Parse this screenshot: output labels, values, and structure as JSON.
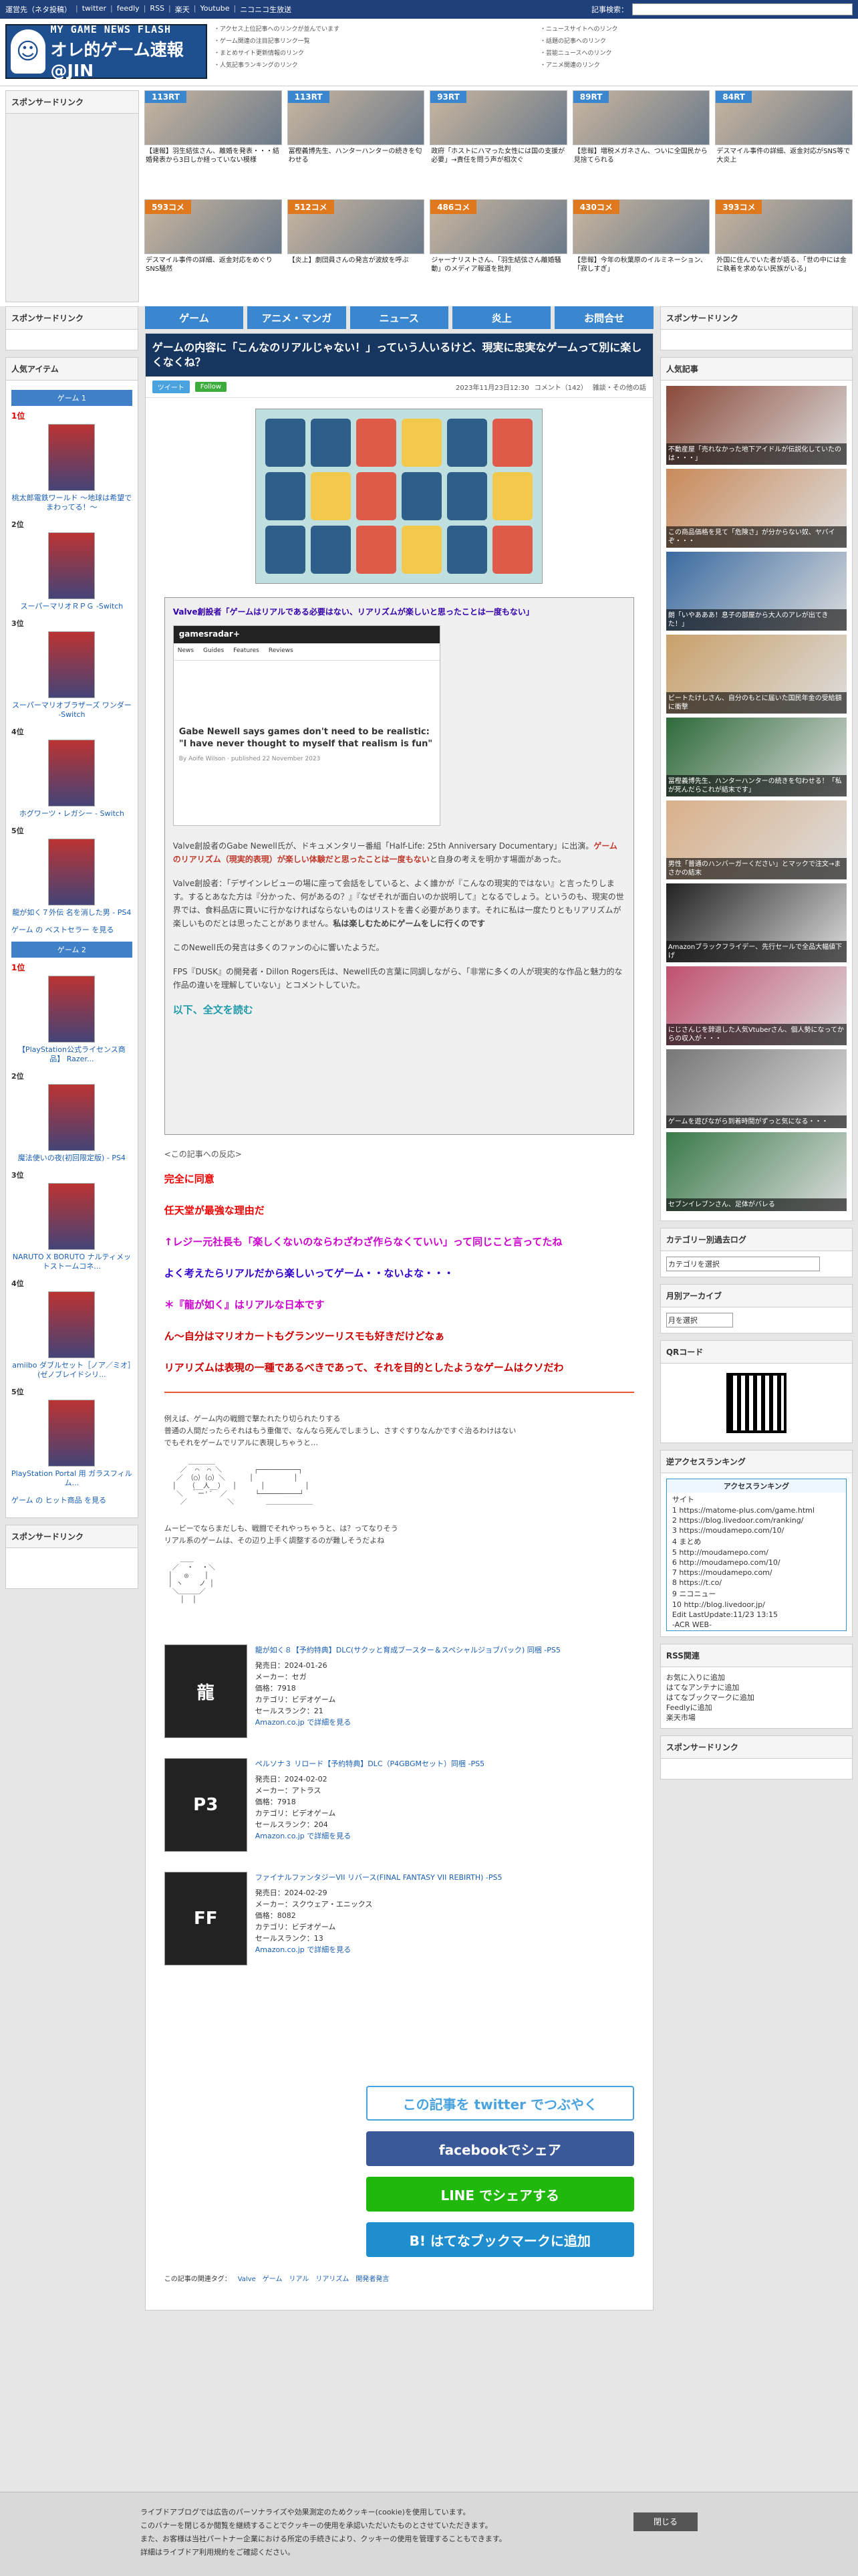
{
  "topbar": {
    "links": [
      "運営先（ネタ投稿）",
      "twitter",
      "feedly",
      "RSS",
      "楽天",
      "Youtube",
      "ニコニコ生放送"
    ],
    "search_label": "記事検索："
  },
  "site": {
    "logo_en": "MY GAME NEWS FLASH",
    "logo_jp": "オレ的ゲーム速報@JIN"
  },
  "header_links": [
    [
      "アクセス上位記事へのリンクが並んでいます",
      "ゲーム関連の注目記事リンク一覧",
      "まとめサイト更新情報のリンク",
      "人気記事ランキングのリンク"
    ],
    [
      "ニュースサイトへのリンク",
      "話題の記事へのリンク",
      "芸能ニュースへのリンク",
      "アニメ関連のリンク"
    ]
  ],
  "sponsor_label": "スポンサードリンク",
  "ad_thumbs": [
    {
      "badge": "113RT",
      "color": "#3a87d0",
      "cap": "【速報】羽生結弦さん、離婚を発表・・・結婚発表から3日しか経っていない模様"
    },
    {
      "badge": "113RT",
      "color": "#3a87d0",
      "cap": "冨樫義博先生、ハンターハンターの続きを匂わせる"
    },
    {
      "badge": "93RT",
      "color": "#3a87d0",
      "cap": "政府「ホストにハマった女性には国の支援が必要」→責任を問う声が相次ぐ"
    },
    {
      "badge": "89RT",
      "color": "#3a87d0",
      "cap": "【悲報】増税メガネさん、ついに全国民から見捨てられる"
    },
    {
      "badge": "84RT",
      "color": "#3a87d0",
      "cap": "デスマイル事件の詳細、返金対応がSNS等で大炎上"
    },
    {
      "badge": "593コメ",
      "color": "#e0781e",
      "cap": "デスマイル事件の詳細、返金対応をめぐりSNS騒然"
    },
    {
      "badge": "512コメ",
      "color": "#e0781e",
      "cap": "【炎上】劇団員さんの発言が波紋を呼ぶ"
    },
    {
      "badge": "486コメ",
      "color": "#e0781e",
      "cap": "ジャーナリストさん、「羽生結弦さん離婚騒動」のメディア報道を批判"
    },
    {
      "badge": "430コメ",
      "color": "#e0781e",
      "cap": "【悲報】今年の秋葉原のイルミネーション、「寂しすぎ」"
    },
    {
      "badge": "393コメ",
      "color": "#e0781e",
      "cap": "外国に住んでいた者が語る、「世の中には金に執着を求めない民族がいる」"
    }
  ],
  "nav": [
    "ゲーム",
    "アニメ・マンガ",
    "ニュース",
    "炎上",
    "お問合せ"
  ],
  "left": {
    "popular_title": "人気アイテム",
    "game1": "ゲーム 1",
    "game2": "ゲーム 2",
    "items1": [
      {
        "rank": "1位",
        "name": "桃太郎電鉄ワールド ～地球は希望でまわってる！～"
      },
      {
        "rank": "2位",
        "name": "スーパーマリオＲＰＧ -Switch"
      },
      {
        "rank": "3位",
        "name": "スーパーマリオブラザーズ ワンダー -Switch"
      },
      {
        "rank": "4位",
        "name": "ホグワーツ・レガシー - Switch"
      },
      {
        "rank": "5位",
        "name": "龍が如く７外伝 名を消した男 - PS4"
      }
    ],
    "more1": "ゲーム の ベストセラー を見る",
    "items2": [
      {
        "rank": "1位",
        "name": "【PlayStation公式ライセンス商品】 Razer..."
      },
      {
        "rank": "2位",
        "name": "魔法使いの夜(初回限定版) - PS4"
      },
      {
        "rank": "3位",
        "name": "NARUTO X BORUTO ナルティメットストームコネ..."
      },
      {
        "rank": "4位",
        "name": "amiibo ダブルセット［ノア／ミオ］(ゼノブレイドシリ..."
      },
      {
        "rank": "5位",
        "name": "PlayStation Portal 用 ガラスフィルム..."
      }
    ],
    "more2": "ゲーム の ヒット商品 を見る"
  },
  "article": {
    "title": "ゲームの内容に「こんなのリアルじゃない！」っていう人いるけど、現実に忠実なゲームって別に楽しくなくね？",
    "tweet": "ツイート",
    "follow": "Follow",
    "date": "2023年11月23日12:30",
    "comments": "コメント（142）",
    "category": "雑談・その他の話",
    "quote_head": "Valve創設者「ゲームはリアルである必要はない、リアリズムが楽しいと思ったことは一度もない」",
    "shot_brand": "gamesradar+",
    "shot_nav": [
      "News",
      "Guides",
      "Features",
      "Reviews"
    ],
    "shot_headline": "Gabe Newell says games don't need to be realistic: \"I have never thought to myself that realism is fun\"",
    "shot_by": "By Aoife Wilson · published 22 November 2023",
    "p1a": "Valve創設者のGabe Newell氏が、ドキュメンタリー番組「Half-Life: 25th Anniversary Documentary」に出演。",
    "p1b": "ゲームのリアリズム（現実的表現）が楽しい体験だと思ったことは一度もない",
    "p1c": "と自身の考えを明かす場面があった。",
    "p2": "Valve創設者：「デザインレビューの場に座って会話をしていると、よく誰かが『こんなの現実的ではない』と言ったりします。するとあなた方は『分かった、何があるの？』『なぜそれが面白いのか説明して』となるでしょう。というのも、現実の世界では、食料品店に買いに行かなければならないものはリストを書く必要があります。それに私は一度たりともリアリズムが楽しいものだとは思ったことがありません。",
    "p2b": "私は楽しむためにゲームをしに行くのです",
    "p3": "このNewell氏の発言は多くのファンの心に響いたようだ。",
    "p4": "FPS『DUSK』の開発者・Dillon Rogers氏は、Newell氏の言葉に同調しながら、「非常に多くの人が現実的な作品と魅力的な作品の違いを理解していない」とコメントしていた。",
    "readmore": "以下、全文を読む",
    "reaction_label": "<この記事への反応>",
    "reactions": [
      {
        "t": "完全に同意",
        "c": "#e00"
      },
      {
        "t": "任天堂が最強な理由だ",
        "c": "#e00"
      },
      {
        "t": "↑レジー元社長も「楽しくないのならわざわざ作らなくていい」って同じこと言ってたね",
        "c": "#c0c"
      },
      {
        "t": "よく考えたらリアルだから楽しいってゲーム・・ないよな・・・",
        "c": "#30c"
      },
      {
        "t": "＊『龍が如く』はリアルな日本です",
        "c": "#c0c"
      },
      {
        "t": "ん～自分はマリオカートもグランツーリスモも好きだけどなぁ",
        "c": "#c00"
      },
      {
        "t": "リアリズムは表現の一種であるべきであって、それを目的としたようなゲームはクソだわ",
        "c": "#c00"
      }
    ],
    "aa1": [
      "例えば、ゲーム内の戦闘で撃たれたり切られたりする",
      "普通の人間だったらそれはもう重傷で、なんなら死んでしまうし、さすぐすりなんかですぐ治るわけはない",
      "でもそれをゲームでリアルに表現しちゃうと…"
    ],
    "aa2": [
      "ムービーでならまだしも、戦闘でそれやっちゃうと、は？ってなりそう",
      "リアル系のゲームは、その辺り上手く調整するのが難しそうだよね"
    ],
    "products": [
      {
        "img": "龍",
        "title": "龍が如く８【予約特典】DLC(サクッと育成ブースター＆スペシャルジョブパック) 同梱 -PS5",
        "release": "発売日：2024-01-26",
        "maker": "メーカー：セガ",
        "price": "価格：7918",
        "cat": "カテゴリ：ビデオゲーム",
        "rank": "セールスランク：21",
        "link": "Amazon.co.jp で詳細を見る"
      },
      {
        "img": "P3",
        "title": "ペルソナ３ リロード【予約特典】DLC（P4GBGMセット）同梱 -PS5",
        "release": "発売日：2024-02-02",
        "maker": "メーカー：アトラス",
        "price": "価格：7918",
        "cat": "カテゴリ：ビデオゲーム",
        "rank": "セールスランク：204",
        "link": "Amazon.co.jp で詳細を見る"
      },
      {
        "img": "FF",
        "title": "ファイナルファンタジーVII リバース(FINAL FANTASY VII REBIRTH) -PS5",
        "release": "発売日：2024-02-29",
        "maker": "メーカー：スクウェア・エニックス",
        "price": "価格：8082",
        "cat": "カテゴリ：ビデオゲーム",
        "rank": "セールスランク：13",
        "link": "Amazon.co.jp で詳細を見る"
      }
    ],
    "share": [
      {
        "t": "この記事を twitter でつぶやく",
        "bg": "#fff",
        "fg": "#4aa3df"
      },
      {
        "t": "facebookでシェア",
        "bg": "#3b5998",
        "fg": "#fff"
      },
      {
        "t": "LINE でシェアする",
        "bg": "#1fb80b",
        "fg": "#fff"
      },
      {
        "t": "B! はてなブックマークに追加",
        "bg": "#1f8ecf",
        "fg": "#fff"
      }
    ],
    "tag_label": "この記事の関連タグ：",
    "tags": [
      "Valve",
      "ゲーム",
      "リアル",
      "リアリズム",
      "開発者発言"
    ]
  },
  "right": {
    "sponsor": "スポンサードリンク",
    "popular": "人気記事",
    "items": [
      "不動産屋「売れなかった地下アイドルが伝説化していたのは・・・」",
      "この商品価格を見て「危険さ」が分からない奴、ヤバイぞ・・・",
      "朗「いやあああ！息子の部屋から大人のアレが出てきた！」",
      "ビートたけしさん、自分のもとに届いた国民年金の受給額に衝撃",
      "冨樫義博先生、ハンターハンターの続きを匂わせる！「私が死んだらこれが結末です」",
      "男性「普通のハンバーガーください」とマックで注文→まさかの結末",
      "Amazonブラックフライデー、先行セールで全品大幅値下げ",
      "にじさんじを辞退した人気Vtuberさん、個人勢になってからの収入が・・・",
      "ゲームを遊びながら到着時間がずっと気になる・・・",
      "セブンイレブンさん、足体がバレる"
    ],
    "cat_title": "カテゴリー別過去ログ",
    "cat_sel": "カテゴリを選択",
    "arch_title": "月別アーカイブ",
    "arch_sel": "月を選択",
    "qr_title": "QRコード",
    "acr_title": "逆アクセスランキング",
    "acr_head": "アクセスランキング",
    "acr": [
      "サイト",
      "1 https://matome-plus.com/game.html",
      "2 https://blog.livedoor.com/ranking/",
      "3 https://moudamepo.com/10/",
      "4 まとめ",
      "5 http://moudamepo.com/",
      "6 http://moudamepo.com/10/",
      "7 https://moudamepo.com/",
      "8 https://t.co/",
      "9 ニコニュー",
      "10 http://blog.livedoor.jp/",
      "Edit LastUpdate:11/23 13:15",
      "-ACR WEB-"
    ],
    "rss_title": "RSS関連",
    "rss": [
      "お気に入りに追加",
      "はてなアンテナに追加",
      "はてなブックマークに追加",
      "Feedlyに追加",
      "楽天市場"
    ],
    "sponsor2": "スポンサードリンク"
  },
  "cookie": {
    "lines": [
      "ライブドアブログでは広告のパーソナライズや効果測定のためクッキー(cookie)を使用しています。",
      "このバナーを閉じるか閲覧を継続することでクッキーの使用を承認いただいたものとさせていただきます。",
      "また、お客様は当社パートナー企業における所定の手続きにより、クッキーの使用を管理することもできます。",
      "詳細はライブドア利用規約をご確認ください。"
    ],
    "close": "閉じる"
  }
}
